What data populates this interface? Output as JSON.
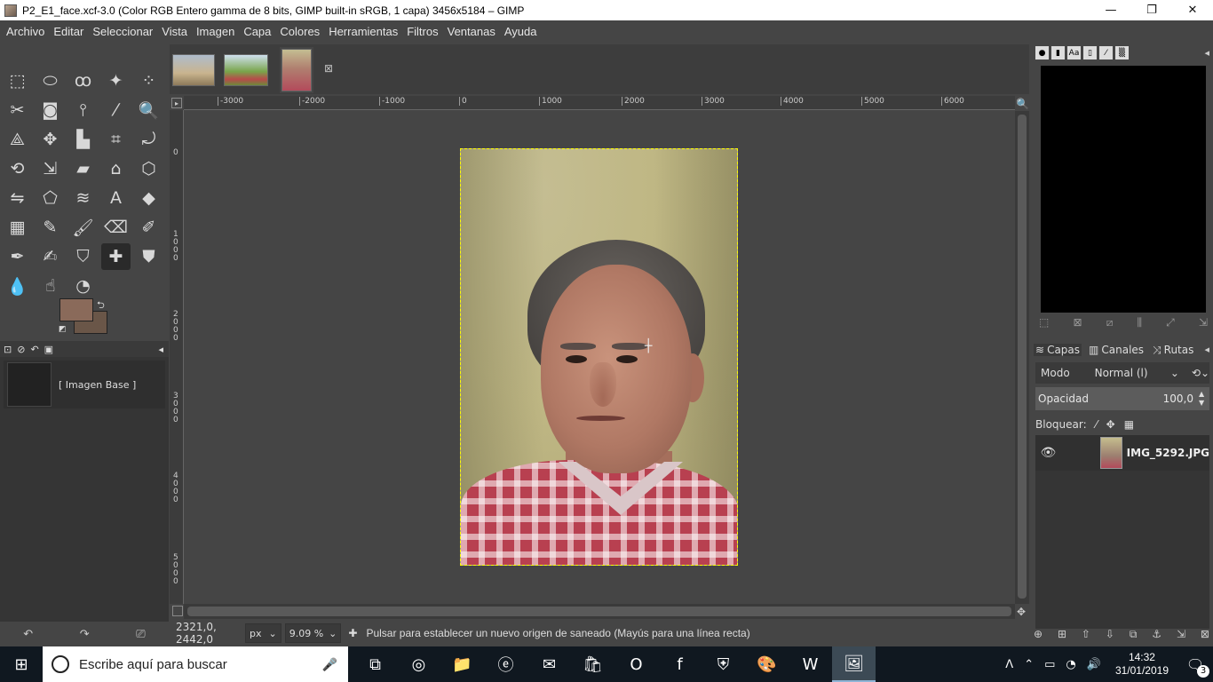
{
  "window": {
    "title": "P2_E1_face.xcf-3.0 (Color RGB Entero gamma de 8 bits, GIMP built-in sRGB, 1 capa) 3456x5184 – GIMP",
    "minimize": "—",
    "maximize": "❐",
    "close": "✕"
  },
  "menu": [
    "Archivo",
    "Editar",
    "Seleccionar",
    "Vista",
    "Imagen",
    "Capa",
    "Colores",
    "Herramientas",
    "Filtros",
    "Ventanas",
    "Ayuda"
  ],
  "toolbox": {
    "tools": [
      {
        "name": "rect-select-tool-icon",
        "glyph": "⬚"
      },
      {
        "name": "ellipse-select-tool-icon",
        "glyph": "⬭"
      },
      {
        "name": "free-select-tool-icon",
        "glyph": "ꝏ"
      },
      {
        "name": "fuzzy-select-tool-icon",
        "glyph": "✦"
      },
      {
        "name": "by-color-select-tool-icon",
        "glyph": "⁘"
      },
      {
        "name": "scissors-select-tool-icon",
        "glyph": "✂"
      },
      {
        "name": "foreground-select-tool-icon",
        "glyph": "◙"
      },
      {
        "name": "paths-tool-icon",
        "glyph": "⫯"
      },
      {
        "name": "color-picker-tool-icon",
        "glyph": "⁄"
      },
      {
        "name": "zoom-tool-icon",
        "glyph": "🔍"
      },
      {
        "name": "measure-tool-icon",
        "glyph": "⟁"
      },
      {
        "name": "move-tool-icon",
        "glyph": "✥"
      },
      {
        "name": "align-tool-icon",
        "glyph": "▙"
      },
      {
        "name": "crop-tool-icon",
        "glyph": "⌗"
      },
      {
        "name": "unified-transform-tool-icon",
        "glyph": "⤾"
      },
      {
        "name": "rotate-tool-icon",
        "glyph": "⟲"
      },
      {
        "name": "scale-tool-icon",
        "glyph": "⇲"
      },
      {
        "name": "shear-tool-icon",
        "glyph": "▰"
      },
      {
        "name": "perspective-tool-icon",
        "glyph": "⌂"
      },
      {
        "name": "3d-transform-tool-icon",
        "glyph": "⬡"
      },
      {
        "name": "flip-tool-icon",
        "glyph": "⇋"
      },
      {
        "name": "cage-transform-tool-icon",
        "glyph": "⬠"
      },
      {
        "name": "warp-transform-tool-icon",
        "glyph": "≋"
      },
      {
        "name": "text-tool-icon",
        "glyph": "A"
      },
      {
        "name": "bucket-fill-tool-icon",
        "glyph": "◆"
      },
      {
        "name": "gradient-tool-icon",
        "glyph": "▦"
      },
      {
        "name": "pencil-tool-icon",
        "glyph": "✎"
      },
      {
        "name": "paintbrush-tool-icon",
        "glyph": "🖌"
      },
      {
        "name": "eraser-tool-icon",
        "glyph": "⌫"
      },
      {
        "name": "airbrush-tool-icon",
        "glyph": "✐"
      },
      {
        "name": "ink-tool-icon",
        "glyph": "✒"
      },
      {
        "name": "mypaint-brush-tool-icon",
        "glyph": "✍"
      },
      {
        "name": "clone-tool-icon",
        "glyph": "⛉"
      },
      {
        "name": "heal-tool-icon",
        "glyph": "✚"
      },
      {
        "name": "perspective-clone-tool-icon",
        "glyph": "⛊"
      },
      {
        "name": "blur-sharpen-tool-icon",
        "glyph": "💧"
      },
      {
        "name": "smudge-tool-icon",
        "glyph": "☝"
      },
      {
        "name": "dodge-burn-tool-icon",
        "glyph": "◔"
      }
    ],
    "active_tool": "heal-tool-icon",
    "fg_color": "#8a6a5a",
    "bg_color": "#6a5648",
    "swap_icon": "⮌",
    "reset_icon": "◩"
  },
  "left_dock": {
    "tabs": [
      "⊡",
      "⊘",
      "↶",
      "▣"
    ],
    "config_icon": "◂",
    "history_item": "[ Imagen Base ]",
    "buttons": [
      "↶",
      "↷",
      "⎚"
    ]
  },
  "image_tabs": {
    "close_icon": "⊠",
    "thumb_colors": [
      "#8e9aa6",
      "#5a7a3a",
      "#b9b08a"
    ]
  },
  "rulers": {
    "top_labels": [
      "-3000",
      "-2000",
      "-1000",
      "0",
      "1000",
      "2000",
      "3000",
      "4000",
      "5000",
      "6000"
    ],
    "left_labels": [
      "0",
      "1000",
      "2000",
      "3000",
      "4000",
      "5000"
    ],
    "corner": "▸",
    "zoom_icon": "🔍",
    "nav_icon": "✥"
  },
  "statusbar": {
    "coords": "2321,0, 2442,0",
    "unit": "px",
    "zoom": "9.09 %",
    "message": "Pulsar para establecer un nuevo origen de saneado (Mayús para una línea recta)",
    "dropdown_icon": "⌄"
  },
  "right_dock": {
    "color_tabs": [
      "●",
      "▮",
      "Aa",
      "▯",
      "⁄",
      "▒"
    ],
    "config_icon": "◂",
    "color_buttons": [
      "⬚",
      "⊠",
      "⧄",
      "⫼",
      "⤢",
      "⇲"
    ],
    "layer_tabs": [
      {
        "icon": "≋",
        "label": "Capas"
      },
      {
        "icon": "▥",
        "label": "Canales"
      },
      {
        "icon": "⤨",
        "label": "Rutas"
      }
    ],
    "mode_label": "Modo",
    "mode_value": "Normal (l)",
    "opacity_label": "Opacidad",
    "opacity_value": "100,0",
    "lock_label": "Bloquear:",
    "lock_icons": [
      "⁄",
      "✥",
      "▦"
    ],
    "layer_name": "IMG_5292.JPG",
    "layer_buttons": [
      "⊕",
      "⊞",
      "⇧",
      "⇩",
      "⧉",
      "⚓",
      "⇲",
      "⊠"
    ]
  },
  "taskbar": {
    "start_icon": "⊞",
    "search_placeholder": "Escribe aquí para buscar",
    "mic_icon": "🎤",
    "apps": [
      {
        "name": "task-view-icon",
        "glyph": "⧉"
      },
      {
        "name": "chrome-icon",
        "glyph": "◎"
      },
      {
        "name": "file-explorer-icon",
        "glyph": "📁"
      },
      {
        "name": "edge-icon",
        "glyph": "ⓔ"
      },
      {
        "name": "mail-icon",
        "glyph": "✉"
      },
      {
        "name": "store-icon",
        "glyph": "🛍"
      },
      {
        "name": "opera-icon",
        "glyph": "O"
      },
      {
        "name": "facebook-icon",
        "glyph": "f"
      },
      {
        "name": "defender-icon",
        "glyph": "⛨"
      },
      {
        "name": "paint-icon",
        "glyph": "🎨"
      },
      {
        "name": "word-icon",
        "glyph": "W"
      },
      {
        "name": "gimp-icon",
        "glyph": "🖼"
      }
    ],
    "tray_icons": [
      "ᐱ",
      "⌃",
      "▭",
      "◔",
      "🔊"
    ],
    "time": "14:32",
    "date": "31/01/2019",
    "notification_icon": "🗨",
    "notification_count": "3"
  }
}
